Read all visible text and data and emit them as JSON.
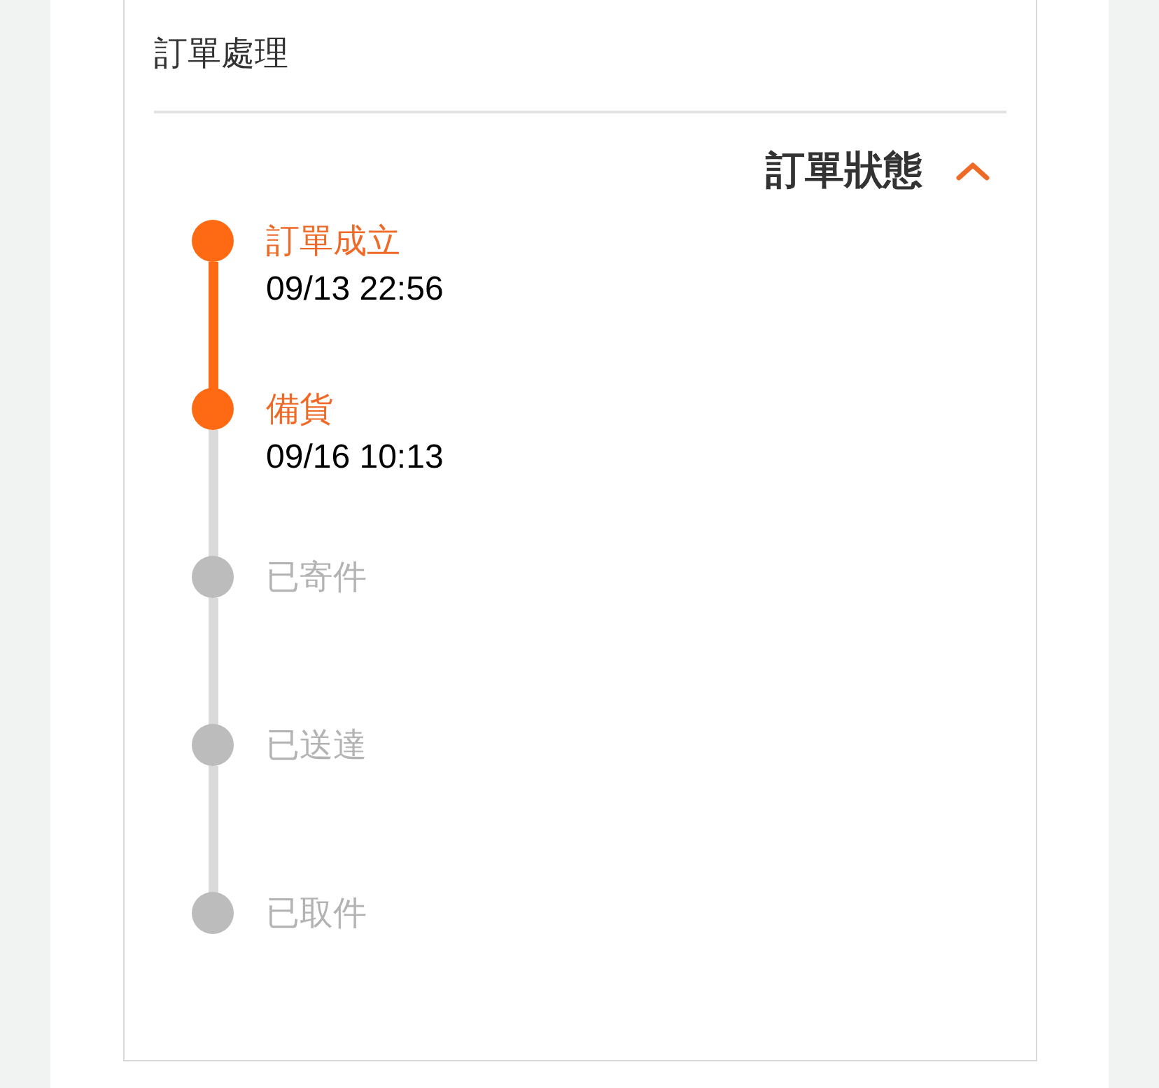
{
  "section_title": "訂單處理",
  "status_header": {
    "label": "訂單狀態",
    "expanded": true
  },
  "steps": [
    {
      "label": "訂單成立",
      "time": "09/13 22:56",
      "done": true
    },
    {
      "label": "備貨",
      "time": "09/16 10:13",
      "done": true
    },
    {
      "label": "已寄件",
      "done": false
    },
    {
      "label": "已送達",
      "done": false
    },
    {
      "label": "已取件",
      "done": false
    }
  ]
}
